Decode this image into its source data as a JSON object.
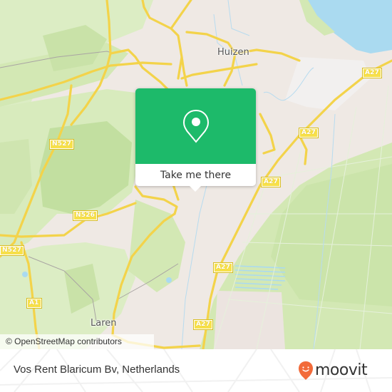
{
  "map": {
    "place_labels": [
      {
        "id": "huizen",
        "text": "Huizen"
      },
      {
        "id": "laren",
        "text": "Laren"
      }
    ],
    "road_shields": [
      {
        "id": "a27-1",
        "text": "A27"
      },
      {
        "id": "a27-2",
        "text": "A27"
      },
      {
        "id": "a27-3",
        "text": "A27"
      },
      {
        "id": "a27-4",
        "text": "A27"
      },
      {
        "id": "a27-5",
        "text": "A27"
      },
      {
        "id": "n527-1",
        "text": "N527"
      },
      {
        "id": "n527-2",
        "text": "N527"
      },
      {
        "id": "n526",
        "text": "N526"
      },
      {
        "id": "a1",
        "text": "A1"
      }
    ],
    "attribution": "© OpenStreetMap contributors",
    "colors": {
      "urban": "#efe9e4",
      "green": "#d3e8b4",
      "forest": "#c2dfa0",
      "water": "#aadaf0",
      "road": "#f7e04a"
    }
  },
  "popup": {
    "icon": "location-pin-icon",
    "button_label": "Take me there",
    "color": "#1dba6a"
  },
  "footer": {
    "place_name": "Vos Rent Blaricum Bv, Netherlands",
    "brand": "moovit",
    "brand_color": "#f26b3a"
  }
}
